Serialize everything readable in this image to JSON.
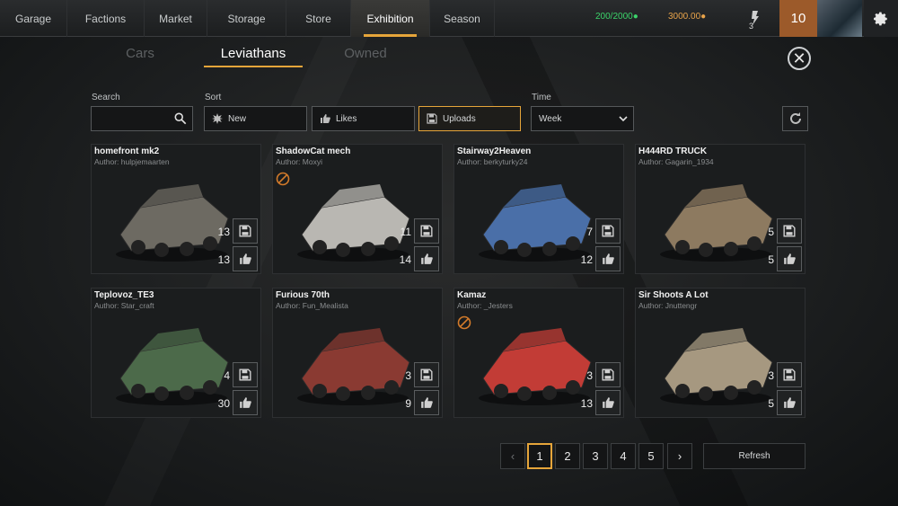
{
  "nav": {
    "items": [
      {
        "label": "Garage",
        "active": false
      },
      {
        "label": "Factions",
        "active": false
      },
      {
        "label": "Market",
        "active": false
      },
      {
        "label": "Storage",
        "active": false
      },
      {
        "label": "Store",
        "active": false
      },
      {
        "label": "Exhibition",
        "active": true
      },
      {
        "label": "Season",
        "active": false
      }
    ],
    "resource_green": "200/2000",
    "resource_orange": "3000.00",
    "rank_badge": "3",
    "level": "10"
  },
  "subtabs": [
    {
      "label": "Cars",
      "active": false
    },
    {
      "label": "Leviathans",
      "active": true
    },
    {
      "label": "Owned",
      "active": false
    }
  ],
  "filters": {
    "search_label": "Search",
    "search_value": "",
    "sort_label": "Sort",
    "sort_options": [
      {
        "label": "New",
        "icon": "star-burst-icon",
        "selected": false
      },
      {
        "label": "Likes",
        "icon": "thumbs-up-icon",
        "selected": false
      },
      {
        "label": "Uploads",
        "icon": "save-icon",
        "selected": true
      }
    ],
    "time_label": "Time",
    "time_value": "Week"
  },
  "cards": [
    {
      "title": "homefront mk2",
      "author": "Author: hulpjemaarten",
      "uploads": "13",
      "likes": "13",
      "banned": false,
      "tint": "#6d6a62"
    },
    {
      "title": "ShadowCat mech",
      "author": "Author: Moxyi",
      "uploads": "11",
      "likes": "14",
      "banned": true,
      "tint": "#b9b7b2"
    },
    {
      "title": "Stairway2Heaven",
      "author": "Author: berkyturky24",
      "uploads": "7",
      "likes": "12",
      "banned": false,
      "tint": "#4a6fa8"
    },
    {
      "title": "H444RD TRUCK",
      "author": "Author: Gagarin_1934",
      "uploads": "5",
      "likes": "5",
      "banned": false,
      "tint": "#8d7a60"
    },
    {
      "title": "Teplovoz_TE3",
      "author": "Author: Star_craft",
      "uploads": "4",
      "likes": "30",
      "banned": false,
      "tint": "#4c6a4a"
    },
    {
      "title": "Furious 70th",
      "author": "Author: Fun_Mealista",
      "uploads": "3",
      "likes": "9",
      "banned": false,
      "tint": "#8a3a32"
    },
    {
      "title": "Kamaz",
      "author": "Author: _Jesters",
      "uploads": "3",
      "likes": "13",
      "banned": true,
      "tint": "#c23c36"
    },
    {
      "title": "Sir Shoots A Lot",
      "author": "Author: Jnuttengr",
      "uploads": "3",
      "likes": "5",
      "banned": false,
      "tint": "#a69880"
    }
  ],
  "pagination": {
    "pages": [
      "1",
      "2",
      "3",
      "4",
      "5"
    ],
    "current": "1",
    "refresh_label": "Refresh"
  },
  "colors": {
    "accent": "#e6a53a",
    "green": "#3bd36a",
    "level_bg": "#9c5a2a"
  }
}
